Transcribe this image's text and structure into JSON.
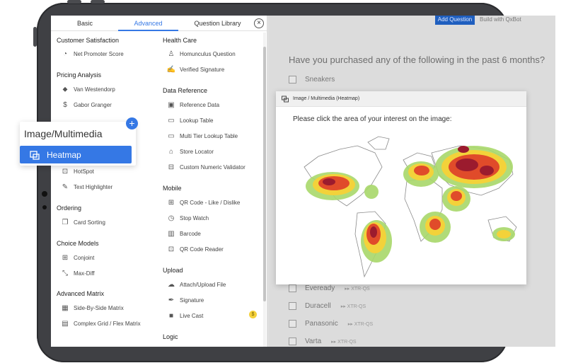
{
  "tabs": [
    {
      "label": "Basic"
    },
    {
      "label": "Advanced"
    },
    {
      "label": "Question Library"
    }
  ],
  "left_column": [
    {
      "title": "Customer Satisfaction",
      "items": [
        "Net Promoter Score"
      ]
    },
    {
      "title": "Pricing Analysis",
      "items": [
        "Van Westendorp",
        "Gabor Granger"
      ]
    },
    {
      "title": "",
      "items": [
        "HotSpot",
        "Text Highlighter"
      ]
    },
    {
      "title": "Ordering",
      "items": [
        "Card Sorting"
      ]
    },
    {
      "title": "Choice Models",
      "items": [
        "Conjoint",
        "Max-Diff"
      ]
    },
    {
      "title": "Advanced Matrix",
      "items": [
        "Side-By-Side Matrix",
        "Complex Grid / Flex Matrix"
      ]
    }
  ],
  "right_column": [
    {
      "title": "Health Care",
      "items": [
        "Homunculus Question",
        "Verified Signature"
      ]
    },
    {
      "title": "Data Reference",
      "items": [
        "Reference Data",
        "Lookup Table",
        "Multi Tier Lookup Table",
        "Store Locator",
        "Custom Numeric Validator"
      ]
    },
    {
      "title": "Mobile",
      "items": [
        "QR Code - Like / Dislike",
        "Stop Watch",
        "Barcode",
        "QR Code Reader"
      ]
    },
    {
      "title": "Upload",
      "items": [
        "Attach/Upload File",
        "Signature",
        "Live Cast"
      ]
    },
    {
      "title": "Logic",
      "items": []
    }
  ],
  "callout": {
    "title": "Image/Multimedia",
    "item": "Heatmap"
  },
  "modal": {
    "title": "Image / Multimedia (Heatmap)",
    "prompt": "Please click the area of your interest on the image:"
  },
  "survey": {
    "top_button": "Add Question",
    "top_link": "Build with QxBot",
    "question": "Have you purchased any of the following in the past 6 months?",
    "first_option": "Sneakers",
    "options": [
      {
        "label": "Eveready",
        "tag": "XTR-QS"
      },
      {
        "label": "Duracell",
        "tag": "XTR-QS"
      },
      {
        "label": "Panasonic",
        "tag": "XTR-QS"
      },
      {
        "label": "Varta",
        "tag": "XTR-QS"
      }
    ]
  },
  "colors": {
    "accent": "#3578e5",
    "tablet": "#3f4044",
    "heat_low": "#a8d86a",
    "heat_mid": "#f3d23a",
    "heat_high": "#e04b2a",
    "heat_peak": "#9b1b2e"
  }
}
